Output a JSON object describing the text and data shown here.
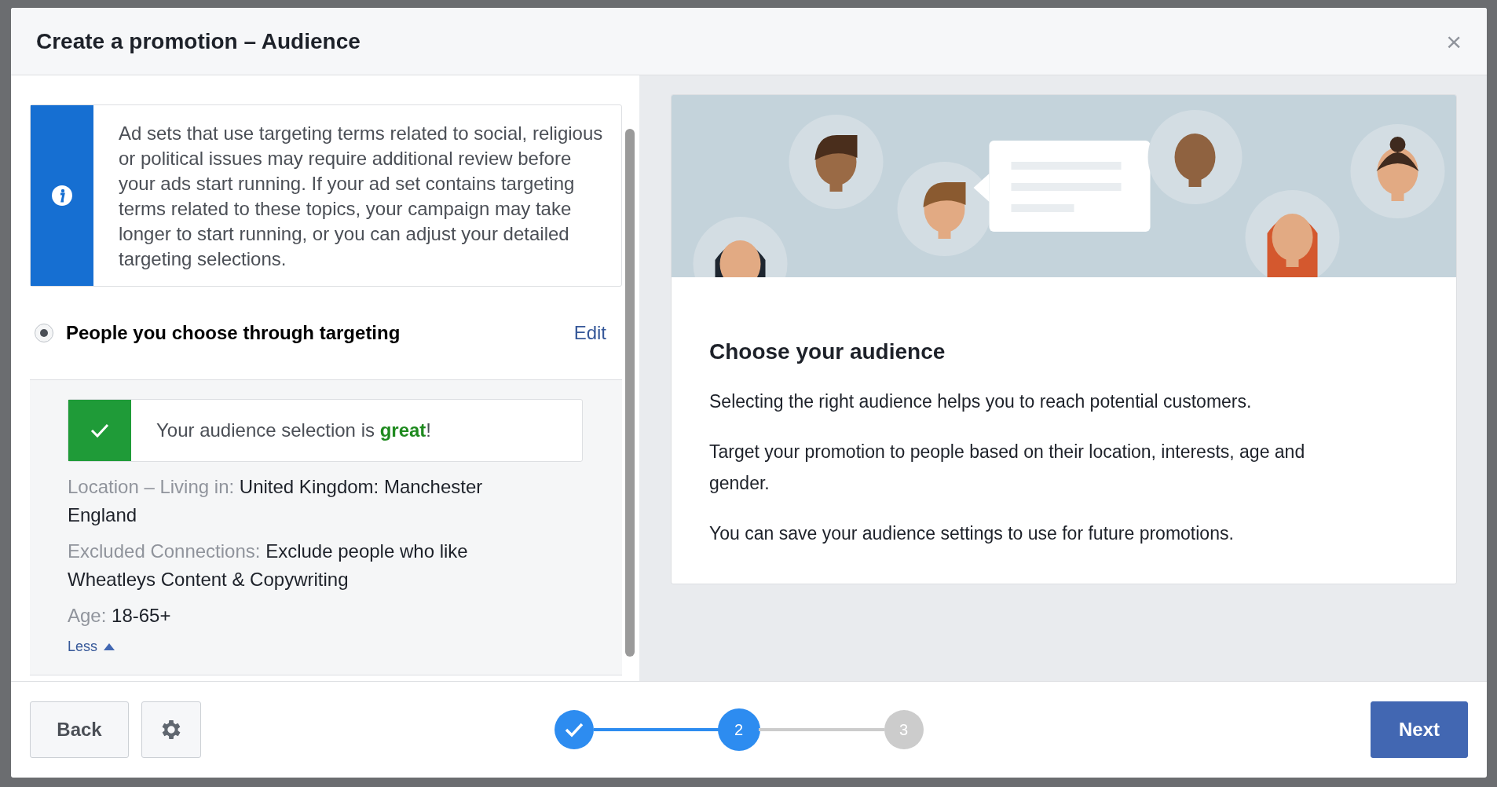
{
  "dialog": {
    "title": "Create a promotion – Audience",
    "close": "×"
  },
  "notice": {
    "text": "Ad sets that use targeting terms related to social, religious or political issues may require additional review before your ads start running. If your ad set contains targeting terms related to these topics, your campaign may take longer to start running, or you can adjust your detailed targeting selections."
  },
  "audience_option": {
    "label": "People you choose through targeting",
    "selected": true,
    "edit": "Edit"
  },
  "audience_status": {
    "text": "Your audience selection is **great**!"
  },
  "details": [
    {
      "label": "Location – Living in:",
      "value": "United Kingdom: Manchester England"
    },
    {
      "label": "Excluded Connections:",
      "value": "Exclude people who like Wheatleys Content & Copywriting"
    },
    {
      "label": "Age:",
      "value": "18-65+"
    }
  ],
  "less_link": "Less",
  "info_card": {
    "title": "Choose your audience",
    "paragraphs": [
      "Selecting the right audience helps you to reach potential customers.",
      "Target your promotion to people based on their location, interests, age and gender.",
      "You can save your audience settings to use for future promotions."
    ]
  },
  "footer": {
    "back": "Back",
    "next": "Next"
  },
  "steps": [
    {
      "completed": true,
      "selected": false
    },
    {
      "label": "2",
      "completed": false,
      "selected": true
    },
    {
      "label": "3",
      "completed": false,
      "selected": false
    }
  ]
}
